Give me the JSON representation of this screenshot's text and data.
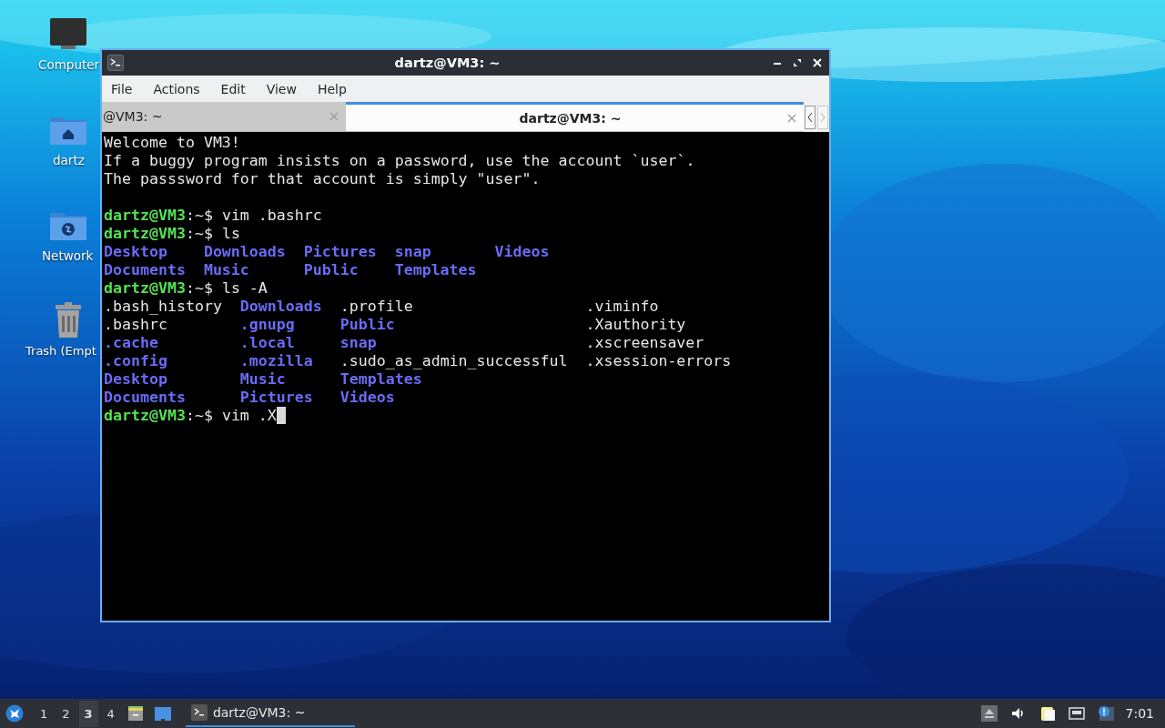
{
  "desktop_icons": [
    {
      "kind": "computer",
      "label": "Computer"
    },
    {
      "kind": "home",
      "label": "dartz"
    },
    {
      "kind": "network",
      "label": "Network"
    },
    {
      "kind": "trash",
      "label": "Trash (Empt"
    }
  ],
  "window": {
    "title": "dartz@VM3: ~",
    "menu": [
      "File",
      "Actions",
      "Edit",
      "View",
      "Help"
    ],
    "tabs": [
      {
        "label": "@VM3: ~",
        "selected": false
      },
      {
        "label": "dartz@VM3: ~",
        "selected": true
      }
    ],
    "terminal": [
      {
        "kind": "text",
        "text": "Welcome to VM3!"
      },
      {
        "kind": "text",
        "text": "If a buggy program insists on a password, use the account `user`."
      },
      {
        "kind": "text",
        "text": "The passsword for that account is simply \"user\"."
      },
      {
        "kind": "blank"
      },
      {
        "kind": "command",
        "prompt": "dartz@VM3",
        "path": ":~$",
        "command": "vim .bashrc",
        "cursor": false
      },
      {
        "kind": "command",
        "prompt": "dartz@VM3",
        "path": ":~$",
        "command": "ls",
        "cursor": false
      },
      {
        "kind": "listing",
        "rows": [
          [
            {
              "name": "Desktop",
              "kind": "dir"
            },
            {
              "name": "Downloads",
              "kind": "dir"
            },
            {
              "name": "Pictures",
              "kind": "dir"
            },
            {
              "name": "snap",
              "kind": "dir"
            },
            {
              "name": "Videos",
              "kind": "dir"
            }
          ],
          [
            {
              "name": "Documents",
              "kind": "dir"
            },
            {
              "name": "Music",
              "kind": "dir"
            },
            {
              "name": "Public",
              "kind": "dir"
            },
            {
              "name": "Templates",
              "kind": "dir"
            }
          ]
        ]
      },
      {
        "kind": "command",
        "prompt": "dartz@VM3",
        "path": ":~$",
        "command": "ls -A",
        "cursor": false
      },
      {
        "kind": "listing",
        "rows": [
          [
            {
              "name": ".bash_history",
              "kind": "file"
            },
            {
              "name": "Downloads",
              "kind": "dir"
            },
            {
              "name": ".profile",
              "kind": "file"
            },
            {
              "name": ".viminfo",
              "kind": "file"
            }
          ],
          [
            {
              "name": ".bashrc",
              "kind": "file"
            },
            {
              "name": ".gnupg",
              "kind": "dir"
            },
            {
              "name": "Public",
              "kind": "dir"
            },
            {
              "name": ".Xauthority",
              "kind": "file"
            }
          ],
          [
            {
              "name": ".cache",
              "kind": "dir"
            },
            {
              "name": ".local",
              "kind": "dir"
            },
            {
              "name": "snap",
              "kind": "dir"
            },
            {
              "name": ".xscreensaver",
              "kind": "file"
            }
          ],
          [
            {
              "name": ".config",
              "kind": "dir"
            },
            {
              "name": ".mozilla",
              "kind": "dir"
            },
            {
              "name": ".sudo_as_admin_successful",
              "kind": "file"
            },
            {
              "name": ".xsession-errors",
              "kind": "file"
            }
          ],
          [
            {
              "name": "Desktop",
              "kind": "dir"
            },
            {
              "name": "Music",
              "kind": "dir"
            },
            {
              "name": "Templates",
              "kind": "dir"
            }
          ],
          [
            {
              "name": "Documents",
              "kind": "dir"
            },
            {
              "name": "Pictures",
              "kind": "dir"
            },
            {
              "name": "Videos",
              "kind": "dir"
            }
          ]
        ]
      },
      {
        "kind": "command",
        "prompt": "dartz@VM3",
        "path": ":~$",
        "command": "vim .X",
        "cursor": true
      }
    ]
  },
  "taskbar": {
    "workspaces": [
      {
        "label": "1",
        "selected": false
      },
      {
        "label": "2",
        "selected": false
      },
      {
        "label": "3",
        "selected": true
      },
      {
        "label": "4",
        "selected": false
      }
    ],
    "tasks": [
      {
        "label": "dartz@VM3: ~",
        "selected": true
      }
    ],
    "clock": "7:01"
  }
}
